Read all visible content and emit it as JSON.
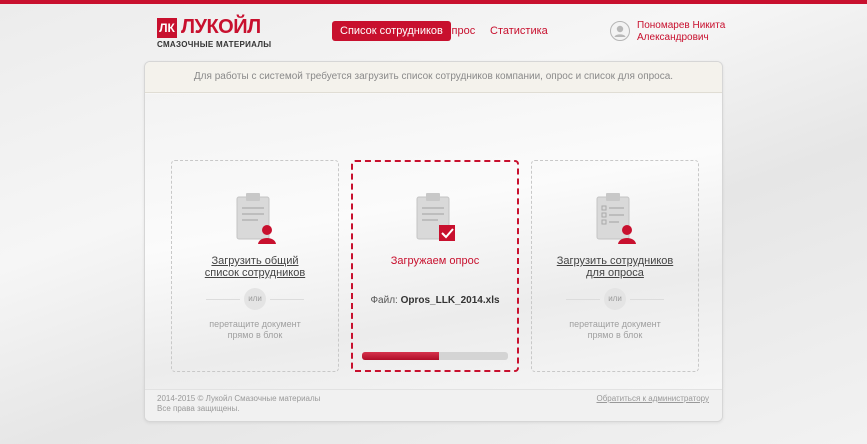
{
  "brand": {
    "logo_mark": "ЛК",
    "logo_word": "ЛУКОЙЛ",
    "logo_sub": "СМАЗОЧНЫЕ МАТЕРИАЛЫ"
  },
  "nav": {
    "items": [
      {
        "label": "Список сотрудников",
        "active": true
      },
      {
        "label": "Опрос",
        "active": false
      },
      {
        "label": "Статистика",
        "active": false
      }
    ]
  },
  "user": {
    "name_line1": "Пономарев Никита",
    "name_line2": "Александрович",
    "avatar_icon": "user-avatar-icon"
  },
  "panel": {
    "message": "Для работы с системой требуется загрузить список сотрудников компании, опрос и список для опроса."
  },
  "cards": [
    {
      "icon": "clipboard-user-icon",
      "title_line1": "Загрузить общий",
      "title_line2": "список сотрудников",
      "or_label": "или",
      "hint_line1": "перетащите документ",
      "hint_line2": "прямо в блок"
    },
    {
      "icon": "clipboard-check-icon",
      "status": "Загружаем опрос",
      "file_label": "Файл:",
      "file_name": "Opros_LLK_2014.xls",
      "progress": 0.53
    },
    {
      "icon": "checklist-user-icon",
      "title_line1": "Загрузить сотрудников",
      "title_line2": "для опроса",
      "or_label": "или",
      "hint_line1": "перетащите документ",
      "hint_line2": "прямо в блок"
    }
  ],
  "footer": {
    "copyright_line1": "2014-2015 © Лукойл Смазочные материалы",
    "copyright_line2": "Все права защищены.",
    "admin_link": "Обратиться к администратору"
  },
  "colors": {
    "accent": "#c8102e",
    "text_muted": "#999999",
    "progress_track": "#d4d4d4"
  }
}
